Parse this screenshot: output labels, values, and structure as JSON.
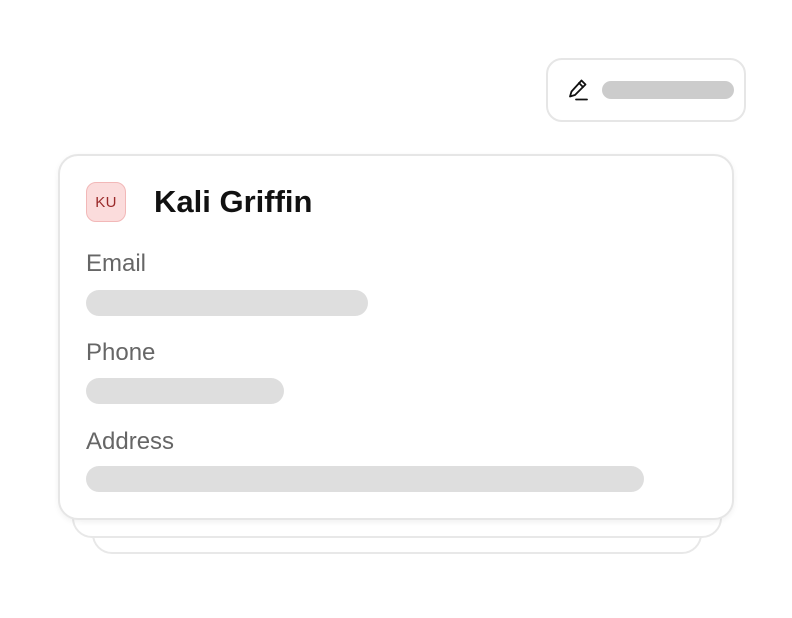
{
  "edit_button": {
    "icon": "pen-icon"
  },
  "contact_card": {
    "avatar_initials": "KU",
    "avatar_bg": "#fbdcdc",
    "avatar_color": "#9a2a2a",
    "name": "Kali Griffin",
    "fields": [
      {
        "label": "Email"
      },
      {
        "label": "Phone"
      },
      {
        "label": "Address"
      }
    ]
  }
}
